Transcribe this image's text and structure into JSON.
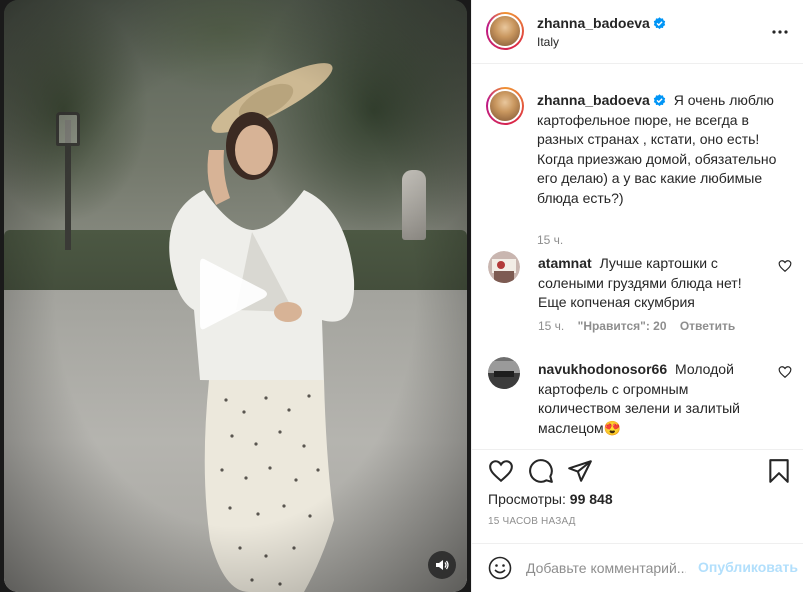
{
  "header": {
    "username": "zhanna_badoeva",
    "location": "Italy"
  },
  "caption": {
    "username": "zhanna_badoeva",
    "text": "Я очень люблю картофельное пюре, не всегда в разных странах , кстати, оно есть! Когда приезжаю домой, обязательно его делаю) а у вас какие любимые блюда есть?)",
    "time": "15 ч."
  },
  "comments": [
    {
      "username": "atamnat",
      "text": "Лучше картошки с солеными груздями блюда нет! Еще копченая скумбрия",
      "time": "15 ч.",
      "likes": "\"Нравится\": 20",
      "reply": "Ответить"
    },
    {
      "username": "navukhodonosor66",
      "text": "Молодой картофель с огромным количеством зелени и залитый маслецом😍"
    }
  ],
  "stats": {
    "views_label": "Просмотры:",
    "views_value": "99 848",
    "timestamp": "15 часов назад"
  },
  "composer": {
    "placeholder": "Добавьте комментарий...",
    "post_label": "Опубликовать"
  },
  "colors": {
    "accent_disabled": "#b2dffc",
    "verified": "#0095f6",
    "muted_text": "#8e8e8e"
  },
  "icons": [
    "play-icon",
    "volume-icon",
    "more-icon",
    "verified-icon",
    "heart-icon",
    "comment-icon",
    "share-icon",
    "bookmark-icon",
    "emoji-icon"
  ]
}
